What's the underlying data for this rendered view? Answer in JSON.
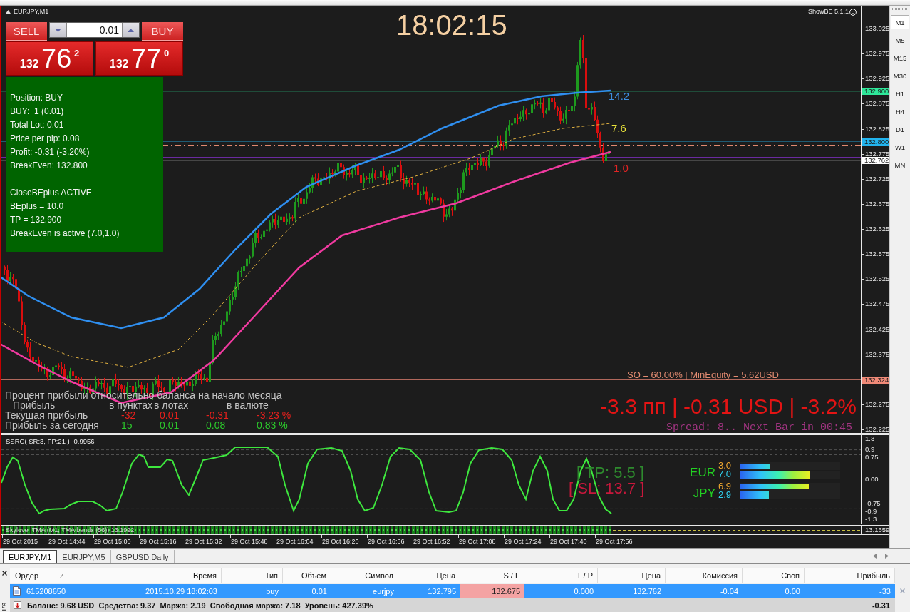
{
  "chart": {
    "title": "EURJPY,M1",
    "trade_panel": {
      "sell_label": "SELL",
      "buy_label": "BUY",
      "lot": "0.01",
      "bid": {
        "prefix": "132",
        "pips": "76",
        "fraction": "2"
      },
      "ask": {
        "prefix": "132",
        "pips": "77",
        "fraction": "0"
      }
    },
    "clock": "18:02:15",
    "indicator_name": "ShowBE 5.1.1",
    "info_box": {
      "groups": [
        [
          "Position: BUY",
          "BUY:  1 (0.01)",
          "Total Lot: 0.01",
          "Price per pip: 0.08",
          "Profit: -0.31 (-3.20%)",
          "BreakEven: 132.800"
        ],
        [
          "CloseBEplus ACTIVE",
          "BEplus = 10.0",
          "TP = 132.900",
          "BreakEven is active (7.0,1.0)"
        ]
      ]
    },
    "line_labels": [
      {
        "text": "14.2",
        "color": "#3d8fe0"
      },
      {
        "text": "7.6",
        "color": "#e8e23a"
      },
      {
        "text": "1.0",
        "color": "#e02424"
      }
    ],
    "so_info": "SO = 60.00% | MinEquity = 5.62USD",
    "result": "-3.3 пп | -0.31 USD | -3.2%",
    "spread_info": "Spread: 8.. Next Bar in 00:45",
    "profit_table": {
      "title": "Процент прибыли относительно баланса на начало месяца",
      "headers": [
        "Прибыль",
        "в пунктах",
        "в лотах",
        "в валюте"
      ],
      "rows": [
        {
          "label": "Текущая прибыль",
          "color": "#e8201c",
          "values": [
            "-32",
            "0.01",
            "-0.31",
            "-3.23 %"
          ]
        },
        {
          "label": "Прибыль за сегодня",
          "color": "#2cc82c",
          "values": [
            "15",
            "0.01",
            "0.08",
            "0.83 %"
          ]
        }
      ]
    },
    "price_axis": [
      "133.025",
      "132.975",
      "132.925",
      "132.875",
      "132.825",
      "132.775",
      "132.725",
      "132.675",
      "132.625",
      "132.575",
      "132.525",
      "132.475",
      "132.425",
      "132.375",
      "132.275",
      "132.225"
    ],
    "price_markers": [
      {
        "text": "132.900",
        "color": "#2ee89a"
      },
      {
        "text": "132.800",
        "color": "#22b4ee"
      },
      {
        "text": "132.762",
        "color": "#ffffff"
      },
      {
        "text": "132.324",
        "color": "#f08a78"
      }
    ]
  },
  "oscillator": {
    "title": "SSRC( SR:3, FP:21 ) -0.9956",
    "axis": [
      "1.3",
      "0.9",
      "0.75",
      "0.00",
      "-0.75",
      "-0.9",
      "-1.3"
    ],
    "tp_label": "[ TP: 5.5 ]",
    "sl_label": "[ SL: 13.7 ]",
    "strength": [
      {
        "currency": "EUR",
        "bars": [
          {
            "value": "3.0",
            "color": "#f0a830",
            "level": 0.3
          },
          {
            "value": "7.0",
            "color": "#30d0f0",
            "level": 0.7
          }
        ]
      },
      {
        "currency": "JPY",
        "bars": [
          {
            "value": "6.9",
            "color": "#f0a830",
            "level": 0.69
          },
          {
            "value": "2.9",
            "color": "#30d0f0",
            "level": 0.29
          }
        ]
      }
    ]
  },
  "tma_pane": {
    "title": "Skylover TMA (M1, TMA bands (56)) 13.1922",
    "axis_label": "13.1659"
  },
  "time_axis": [
    "29 Oct 2015",
    "29 Oct 14:44",
    "29 Oct 15:00",
    "29 Oct 15:16",
    "29 Oct 15:32",
    "29 Oct 15:48",
    "29 Oct 16:04",
    "29 Oct 16:20",
    "29 Oct 16:36",
    "29 Oct 16:52",
    "29 Oct 17:08",
    "29 Oct 17:24",
    "29 Oct 17:40",
    "29 Oct 17:56"
  ],
  "timeframes": [
    {
      "label": "M1",
      "selected": true
    },
    {
      "label": "M5",
      "selected": false
    },
    {
      "label": "M15",
      "selected": false
    },
    {
      "label": "M30",
      "selected": false
    },
    {
      "label": "H1",
      "selected": false
    },
    {
      "label": "H4",
      "selected": false
    },
    {
      "label": "D1",
      "selected": false
    },
    {
      "label": "W1",
      "selected": false
    },
    {
      "label": "MN",
      "selected": false
    }
  ],
  "chart_tabs": [
    {
      "label": "EURJPY,M1",
      "selected": true
    },
    {
      "label": "EURJPY,M5",
      "selected": false
    },
    {
      "label": "GBPUSD,Daily",
      "selected": false
    }
  ],
  "terminal": {
    "side_label": "ал",
    "columns": [
      "Ордер",
      "Время",
      "Тип",
      "Объем",
      "Символ",
      "Цена",
      "S / L",
      "T / P",
      "Цена",
      "Комиссия",
      "Своп",
      "Прибыль"
    ],
    "rows": [
      {
        "selected": true,
        "sl_alert": true,
        "cells": [
          "615208650",
          "2015.10.29 18:02:03",
          "buy",
          "0.01",
          "eurjpy",
          "132.795",
          "132.675",
          "0.000",
          "132.762",
          "-0.04",
          "0.00",
          "-33"
        ]
      }
    ],
    "summary": "Баланс: 9.68 USD  Средства: 9.37  Маржа: 2.19  Свободная маржа: 7.18  Уровень: 427.39%",
    "summary_total": "-0.31"
  }
}
